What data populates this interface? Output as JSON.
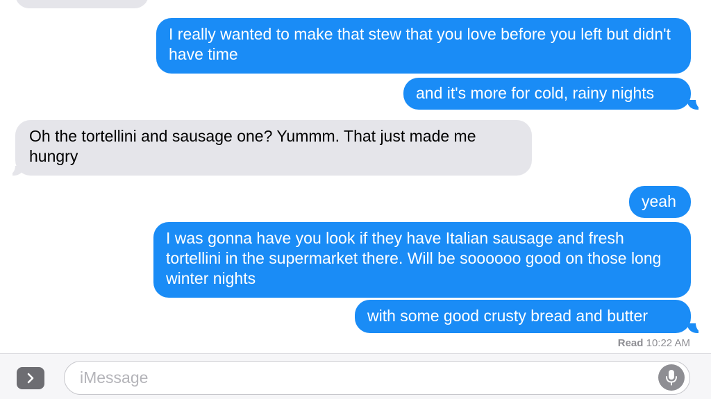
{
  "conversation": {
    "messages": [
      {
        "direction": "sent",
        "text": "I really wanted to make that stew that you love before you left but didn't have time"
      },
      {
        "direction": "sent",
        "text": "and it's more for cold, rainy nights"
      },
      {
        "direction": "received",
        "text": "Oh the tortellini and sausage one? Yummm. That just made me hungry"
      },
      {
        "direction": "sent",
        "text": "yeah"
      },
      {
        "direction": "sent",
        "text": "I was gonna have you look if they have Italian sausage and fresh tortellini in the supermarket there. Will be soooooo good on those long winter nights"
      },
      {
        "direction": "sent",
        "text": "with some good crusty bread and butter"
      }
    ],
    "read_receipt": {
      "label": "Read",
      "time": "10:22 AM"
    }
  },
  "composer": {
    "placeholder": "iMessage",
    "value": "",
    "expand_icon": "chevron-right-icon",
    "mic_icon": "microphone-icon"
  },
  "colors": {
    "sent_bubble": "#1a8cf6",
    "received_bubble": "#e5e5ea",
    "background": "#ffffff"
  }
}
